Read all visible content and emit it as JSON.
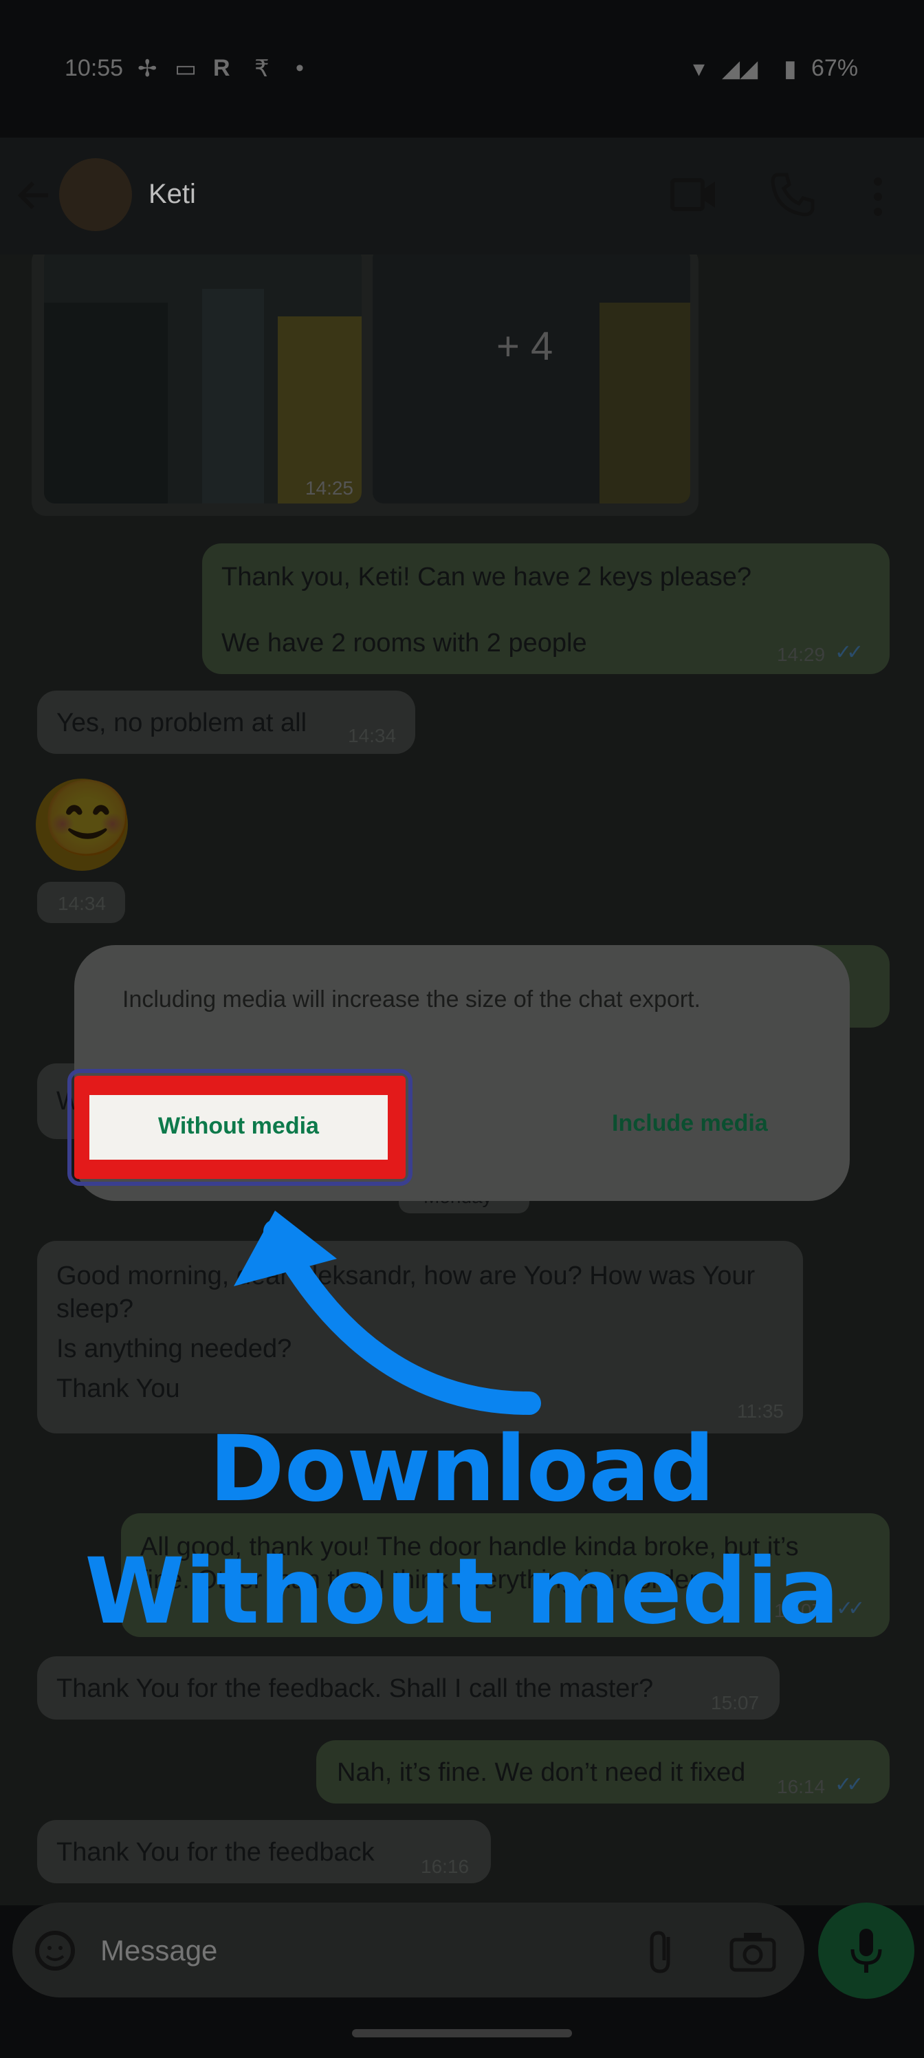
{
  "status_bar": {
    "time": "10:55",
    "battery": "67%"
  },
  "header": {
    "contact_name": "Keti"
  },
  "chat": {
    "photo_time": "14:25",
    "photo_more": "+ 4",
    "messages": [
      {
        "id": "m1",
        "lines": [
          "Thank you, Keti! Can we have 2 keys please?",
          "We have 2 rooms with 2 people"
        ],
        "time": "14:29"
      },
      {
        "id": "m2",
        "text": "Yes, no problem at all",
        "time": "14:34"
      },
      {
        "id": "m3",
        "emoji": "😊",
        "time": "14:34"
      },
      {
        "id": "m4",
        "lines": [
          "Good morning, dear Aleksandr, how are You? How was Your sleep?",
          "Is anything needed?",
          "Thank You"
        ],
        "time": "11:35"
      },
      {
        "id": "m5",
        "lines": [
          "All good, thank you! The door handle kinda broke, but it’s",
          "fine. Other than that I think everything is in order."
        ],
        "time": "15:07"
      },
      {
        "id": "m6",
        "text": "Thank You for the feedback. Shall I call the master?",
        "time": "15:07"
      },
      {
        "id": "m7",
        "text": "Nah, it’s fine. We don’t need it fixed",
        "time": "16:14"
      },
      {
        "id": "m8",
        "text": "Thank You for the feedback",
        "time": "16:16"
      }
    ],
    "date_chip": "Monday"
  },
  "dialog": {
    "message": "Including media will increase the size of the chat export.",
    "without_media": "Without media",
    "include_media": "Include media"
  },
  "annotation": {
    "line1": "Download",
    "line2": "Without media"
  },
  "composer": {
    "placeholder": "Message"
  }
}
